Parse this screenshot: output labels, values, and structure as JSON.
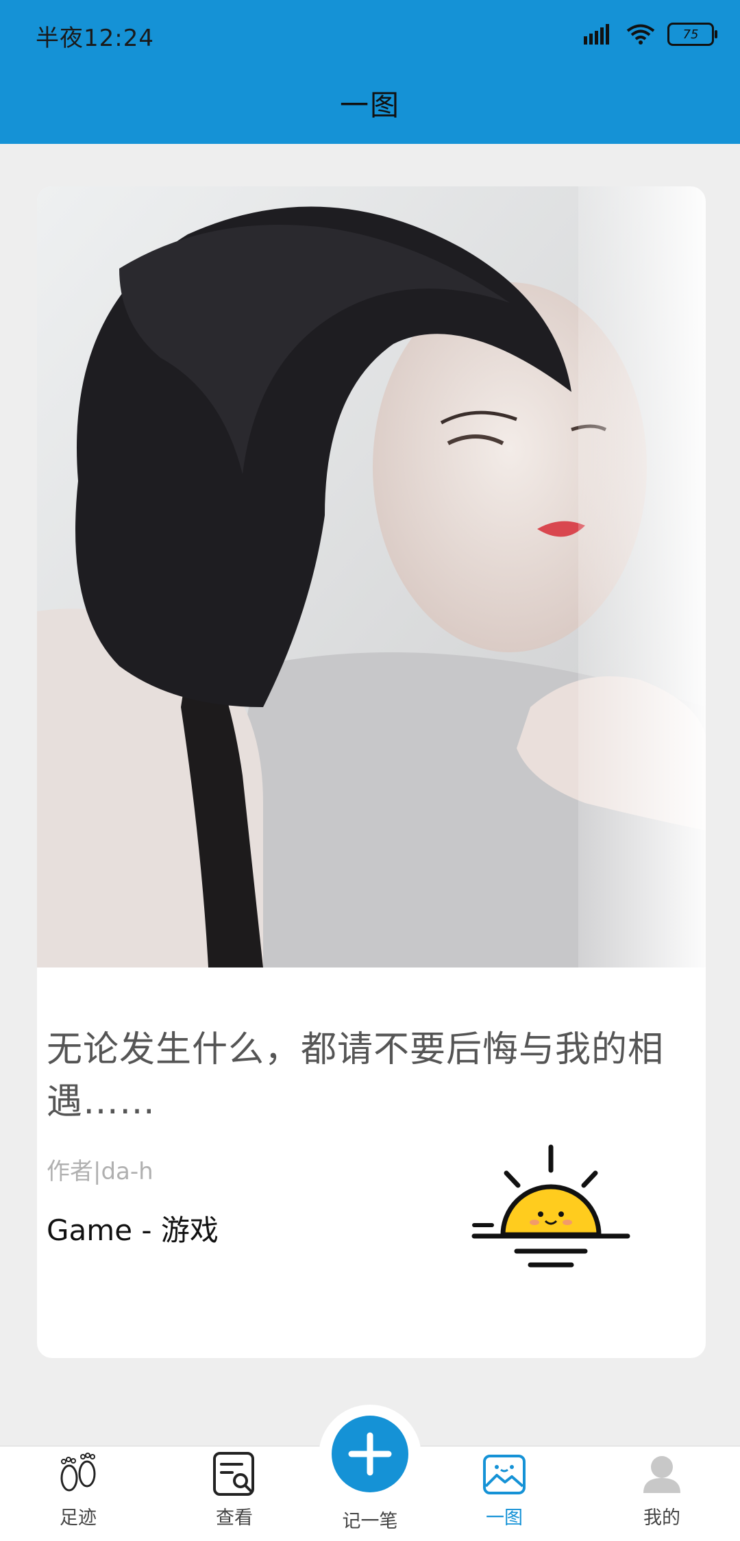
{
  "status_bar": {
    "time": "半夜12:24",
    "battery": "75"
  },
  "header": {
    "title": "一图"
  },
  "card": {
    "quote": "无论发生什么，都请不要后悔与我的相遇……",
    "author": "作者|da-h",
    "category": "Game - 游戏"
  },
  "bottom_nav": {
    "items": [
      {
        "label": "足迹",
        "icon": "footprints-icon"
      },
      {
        "label": "查看",
        "icon": "view-search-icon"
      },
      {
        "label": "记一笔",
        "icon": "add-icon"
      },
      {
        "label": "一图",
        "icon": "image-icon",
        "active": true
      },
      {
        "label": "我的",
        "icon": "profile-icon"
      }
    ]
  },
  "colors": {
    "accent": "#1592d6",
    "background": "#eeeeee",
    "card": "#ffffff"
  }
}
